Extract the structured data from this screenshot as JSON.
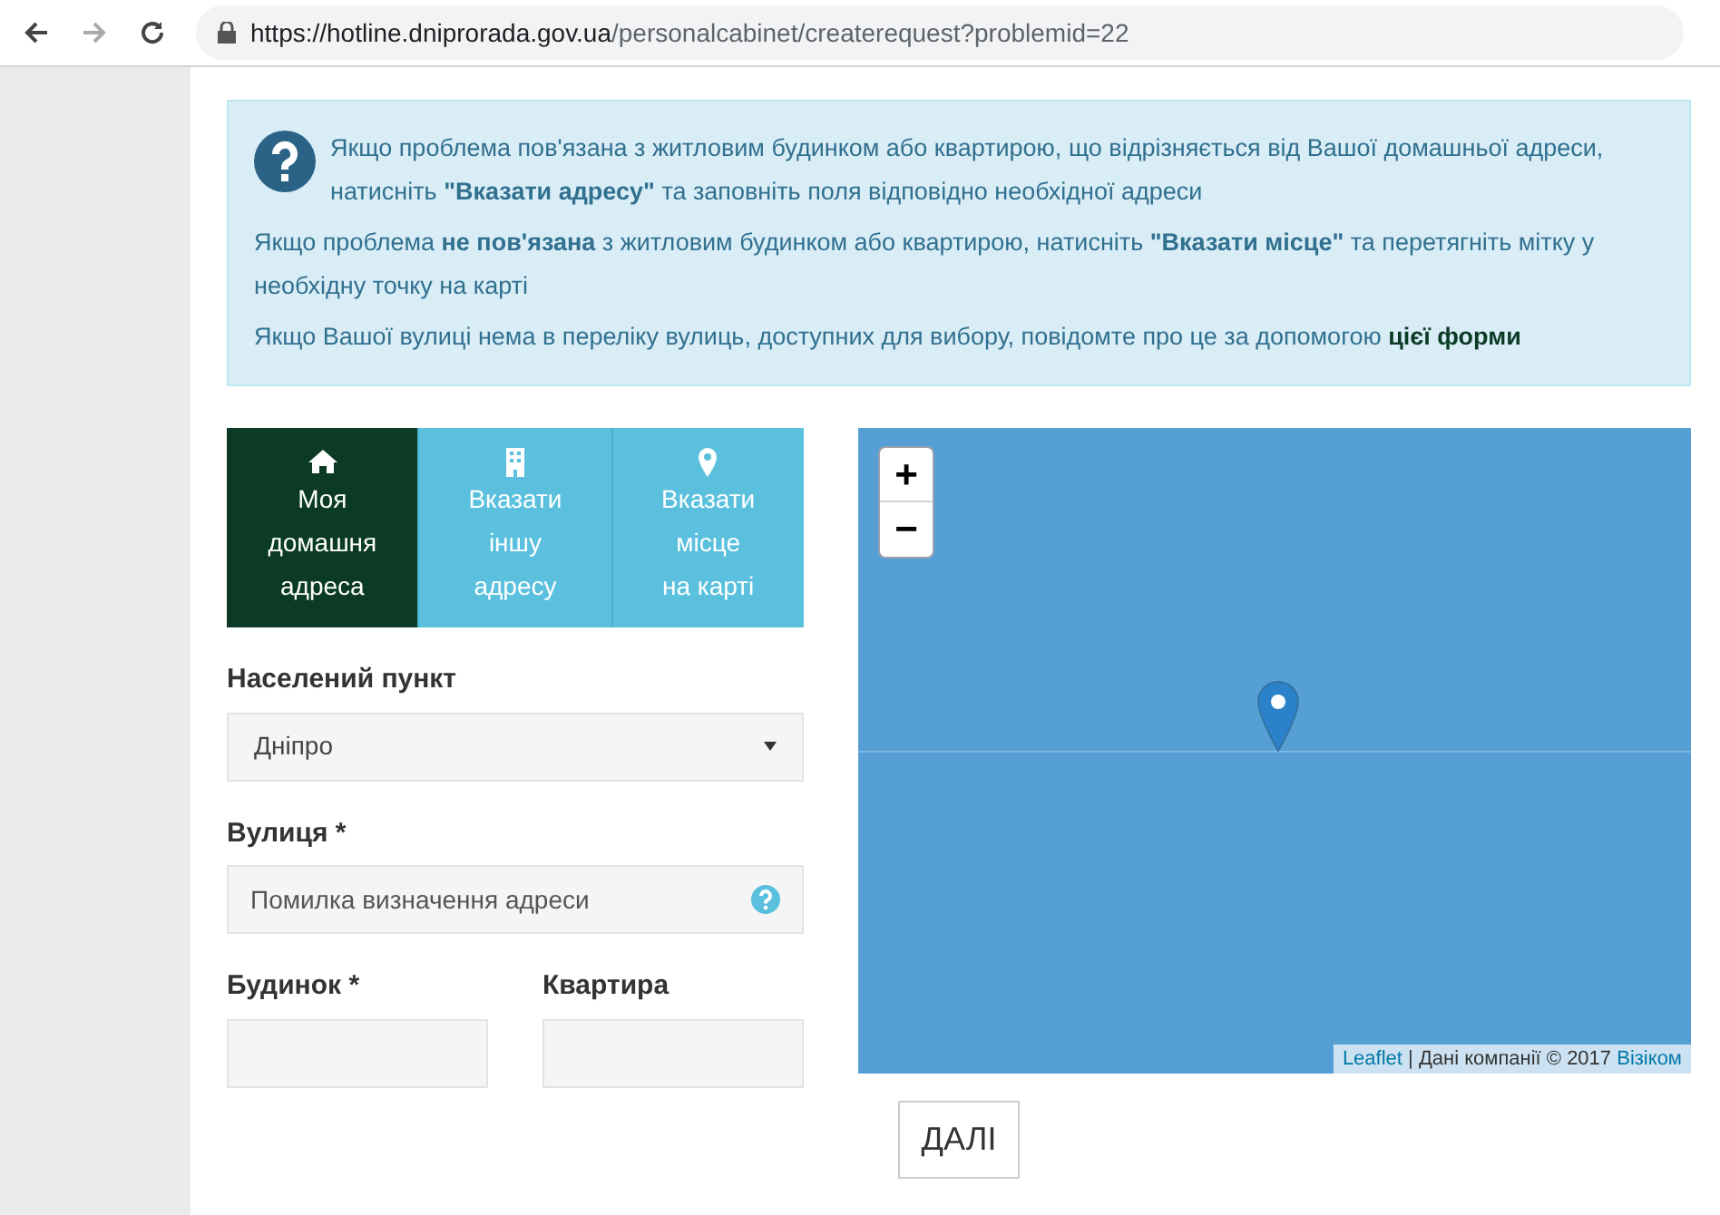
{
  "browser": {
    "url_host": "https://hotline.dniprorada.gov.ua",
    "url_path": "/personalcabinet/createrequest?problemid=22"
  },
  "info": {
    "paragraphs": [
      "Якщо проблема пов'язана з житловим будинком або квартирою, що відрізняється від Вашої домашньої адреси, натисніть **\"Вказати адресу\"** та заповніть поля відповідно необхідної адреси",
      "Якщо проблема **не пов'язана** з житловим будинком або квартирою, натисніть **\"Вказати місце\"** та перетягніть мітку у необхідну точку на карті"
    ],
    "note": "Якщо Вашої вулиці нема в переліку вулиць, доступних для вибору, повідомте про це за допомогою",
    "note_link": "цієї форми"
  },
  "tabs": [
    {
      "kind": "home",
      "label": "Моя\nдомашня\nадреса",
      "selected": true
    },
    {
      "kind": "building",
      "label": "Вказати\nіншу\nадресу",
      "selected": false
    },
    {
      "kind": "pin",
      "label": "Вказати\nмісце\nна карті",
      "selected": false
    }
  ],
  "form": {
    "city_label": "Населений пункт",
    "city_value": "Дніпро",
    "street_label": "Вулиця *",
    "street_value": "Помилка визначення адреси",
    "house_label": "Будинок *",
    "flat_label": "Квартира"
  },
  "map": {
    "zoom_in": "+",
    "zoom_out": "−",
    "attribution_link": "Leaflet",
    "attribution_text": "| Дані компанії © 2017",
    "attribution_provider": "Візіком"
  },
  "next_button": "ДАЛІ"
}
